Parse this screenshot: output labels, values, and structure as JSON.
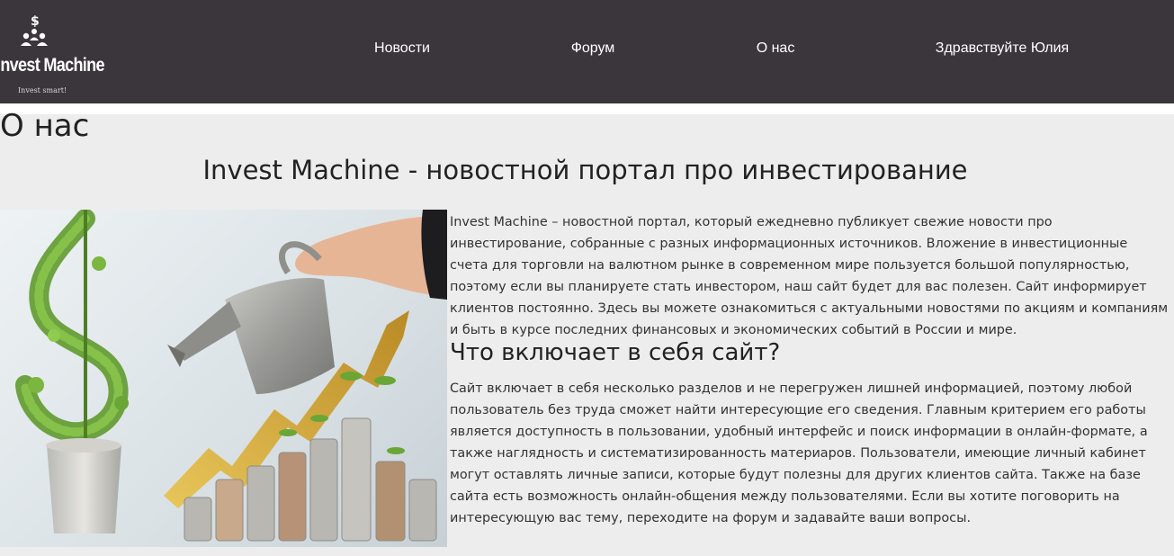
{
  "brand": {
    "name": "Invest Machine",
    "tagline": "Invest smart!"
  },
  "nav": {
    "items": [
      {
        "label": "Новости"
      },
      {
        "label": "Форум"
      },
      {
        "label": "О нас"
      },
      {
        "label": "Здравствуйте Юлия"
      }
    ]
  },
  "page": {
    "title": "О нас",
    "subtitle": "Invest Machine - новостной портал про инвестирование",
    "hero_image": "investment-growth-illustration",
    "intro": "Invest Machine – новостной портал, который ежедневно публикует свежие новости про инвестирование, собранные с разных информационных источников. Вложение в инвестиционные счета для торговли на валютном рынке в современном мире пользуется большой популярностью, поэтому если вы планируете стать инвестором, наш сайт будет для вас полезен. Сайт информирует клиентов постоянно. Здесь вы можете ознакомиться с актуальными новостями по акциям и компаниям и быть в курсе последних финансовых и экономических событий в России и мире.",
    "section_heading": "Что включает в себя сайт?",
    "section_body": "Сайт включает в себя несколько разделов и не перегружен лишней информацией, поэтому любой пользователь без труда сможет найти интересующие его сведения. Главным критерием его работы является доступность в пользовании, удобный интерфейс и поиск информации в онлайн-формате, а также наглядность и систематизированность материаров. Пользователи, имеющие личный кабинет могут оставлять личные записи, которые будут полезны для других клиентов сайта. Также на базе сайта есть возможность онлайн-общения между пользователями. Если вы хотите поговорить на интересующую вас тему, переходите на форум и задавайте ваши вопросы."
  },
  "colors": {
    "header_bg": "#3b353c",
    "page_bg": "#ededed",
    "text": "#222222",
    "accent_gold": "#c9a035",
    "leaf_green": "#6aa636"
  }
}
